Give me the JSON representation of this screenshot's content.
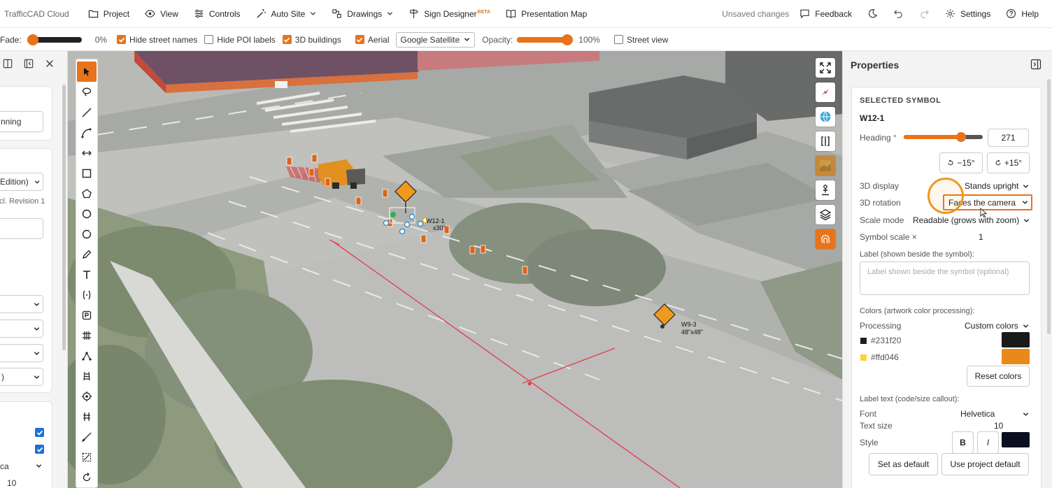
{
  "app": {
    "title": "TrafficCAD Cloud"
  },
  "menu": {
    "project": "Project",
    "view": "View",
    "controls": "Controls",
    "auto_site": "Auto Site",
    "drawings": "Drawings",
    "sign_designer": "Sign Designer",
    "sign_designer_badge": "BETA",
    "presentation_map": "Presentation Map",
    "unsaved": "Unsaved changes",
    "feedback": "Feedback",
    "settings": "Settings",
    "help": "Help"
  },
  "toolbar": {
    "fade_label": "Fade:",
    "fade_value": "0%",
    "fade_level": 0,
    "hide_street_names": {
      "label": "Hide street names",
      "checked": true
    },
    "hide_poi_labels": {
      "label": "Hide POI labels",
      "checked": false
    },
    "buildings_3d": {
      "label": "3D buildings",
      "checked": true
    },
    "aerial": {
      "label": "Aerial",
      "checked": true
    },
    "imagery_source": "Google Satellite",
    "opacity_label": "Opacity:",
    "opacity_value": "100%",
    "opacity_level": 1.0,
    "street_view": {
      "label": "Street view",
      "checked": false
    }
  },
  "left_panel": {
    "field_running": "nning",
    "select_edition": "Edition)",
    "revision_text": "cl. Revision 1",
    "font_partial": "ca",
    "size_partial": "10",
    "select_partial": ")"
  },
  "map": {
    "sign_w9_code": "W9-3",
    "sign_w9_size": "48\"x48\"",
    "sign_w12_code": "W12-1",
    "sign_w12_size": "x30\""
  },
  "properties": {
    "title": "Properties",
    "section": "SELECTED SYMBOL",
    "symbol_code": "W12-1",
    "heading_label": "Heading °",
    "heading_value": "271",
    "heading_level": 0.7528,
    "rotate_minus": "−15°",
    "rotate_plus": "+15°",
    "display_3d_label": "3D display",
    "display_3d_value": "Stands upright",
    "rotation_3d_label": "3D rotation",
    "rotation_3d_value": "Faces the camera",
    "scale_mode_label": "Scale mode",
    "scale_mode_value": "Readable (grows with zoom)",
    "symbol_scale_label": "Symbol scale ×",
    "symbol_scale_value": "1",
    "label_section": "Label (shown beside the symbol):",
    "label_placeholder": "Label shown beside the symbol (optional)",
    "colors_section": "Colors (artwork color processing):",
    "processing_label": "Processing",
    "processing_value": "Custom colors",
    "color1_hex": "#231f20",
    "color2_hex": "#ffd046",
    "color1_swatch": "#1a1a1a",
    "color2_swatch": "#e8891a",
    "reset_colors": "Reset colors",
    "label_text_section": "Label text (code/size callout):",
    "font_label": "Font",
    "font_value": "Helvetica",
    "text_size_label": "Text size",
    "text_size_value": "10",
    "style_label": "Style",
    "bold": "B",
    "italic": "I",
    "style_color": "#0b1020",
    "set_default": "Set as default",
    "use_project_default": "Use project default"
  },
  "colors": {
    "accent": "#e8731a",
    "focus_ring": "#f0961f"
  }
}
